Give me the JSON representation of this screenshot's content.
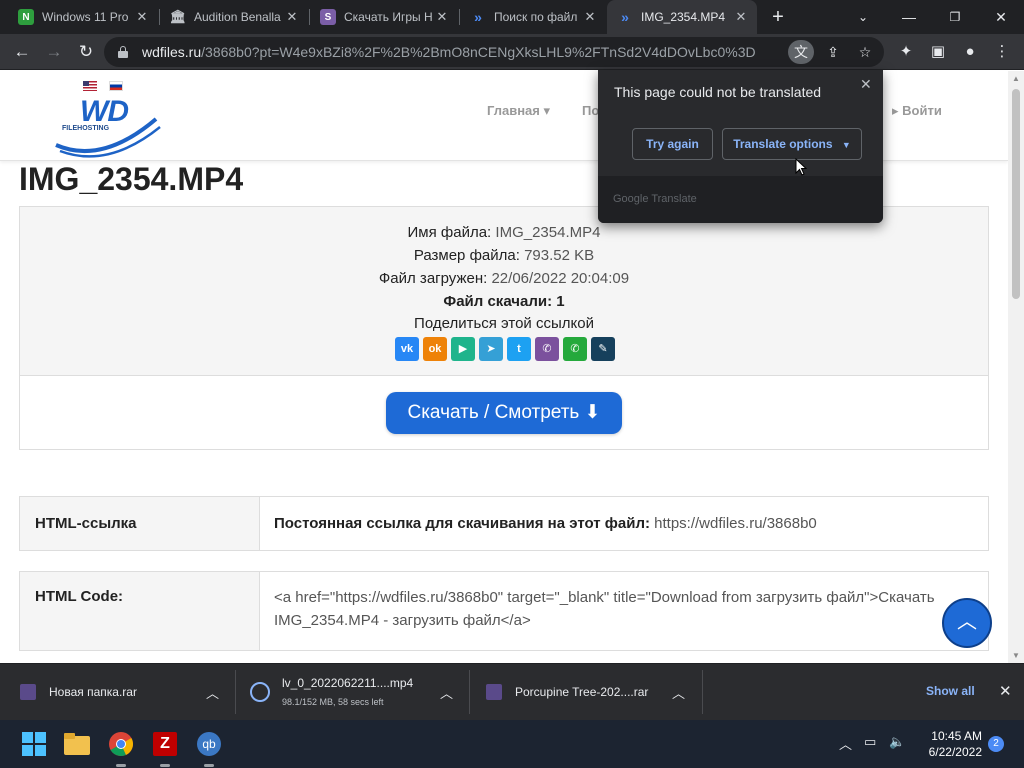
{
  "tabs": [
    {
      "title": "Windows 11 Pro",
      "favicon": "green-n-icon",
      "color": "#2e9e3e"
    },
    {
      "title": "Audition Benalla",
      "favicon": "institution-icon",
      "color": "#888888"
    },
    {
      "title": "Скачать Игры Н",
      "favicon": "s-icon",
      "color": "#7b5ea7"
    },
    {
      "title": "Поиск по файл",
      "favicon": "chevrons-icon",
      "color": "#4c8bf5"
    },
    {
      "title": "IMG_2354.MP4",
      "favicon": "chevrons-icon",
      "color": "#4c8bf5",
      "active": true
    }
  ],
  "toolbar": {
    "url_host": "wdfiles.ru",
    "url_path": "/3868b0?pt=W4e9xBZi8%2F%2B%2BmO8nCENgXksLHL9%2FTnSd2V4dDOvLbc0%3D"
  },
  "site": {
    "logo_text": "WD",
    "logo_sub": "FILEHOSTING",
    "nav": {
      "home": "Главная ▾",
      "partial": "По",
      "login": "▸ Войти"
    }
  },
  "file": {
    "title": "IMG_2354.MP4",
    "name_label": "Имя файла:",
    "name_value": "IMG_2354.MP4",
    "size_label": "Размер файла:",
    "size_value": "793.52 KB",
    "uploaded_label": "Файл загружен:",
    "uploaded_value": "22/06/2022 20:04:09",
    "downloads_text": "Файл скачали: 1",
    "share_text": "Поделиться этой ссылкой",
    "download_button": "Скачать / Смотреть ⬇"
  },
  "share_buttons": [
    {
      "name": "vk",
      "label": "vk",
      "color": "#2787f5"
    },
    {
      "name": "odnoklassniki",
      "label": "ok",
      "color": "#ee8208"
    },
    {
      "name": "yandex-messenger",
      "label": "▶",
      "color": "#1fb48c"
    },
    {
      "name": "telegram",
      "label": "➤",
      "color": "#35a0d6"
    },
    {
      "name": "twitter",
      "label": "t",
      "color": "#1da1f2"
    },
    {
      "name": "viber",
      "label": "✆",
      "color": "#7b519d"
    },
    {
      "name": "whatsapp",
      "label": "✆",
      "color": "#25a93c"
    },
    {
      "name": "livejournal",
      "label": "✎",
      "color": "#16405c"
    }
  ],
  "links": {
    "html_label": "HTML-ссылка",
    "permanent_label": "Постоянная ссылка для скачивания на этот файл:",
    "permanent_url": "https://wdfiles.ru/3868b0",
    "code_label": "HTML Code:",
    "code_value": "<a href=\"https://wdfiles.ru/3868b0\" target=\"_blank\" title=\"Download from загрузить файл\">Скачать IMG_2354.MP4 - загрузить файл</a>"
  },
  "translate_popup": {
    "title": "This page could not be translated",
    "try_again": "Try again",
    "options": "Translate options",
    "footer": "Google Translate"
  },
  "downloads": [
    {
      "name": "Новая папка.rar",
      "status": ""
    },
    {
      "name": "lv_0_2022062211....mp4",
      "status": "98.1/152 MB, 58 secs left"
    },
    {
      "name": "Porcupine Tree-202....rar",
      "status": ""
    }
  ],
  "shelf": {
    "show_all": "Show all"
  },
  "taskbar": {
    "time": "10:45 AM",
    "date": "6/22/2022",
    "notifications": "2"
  }
}
